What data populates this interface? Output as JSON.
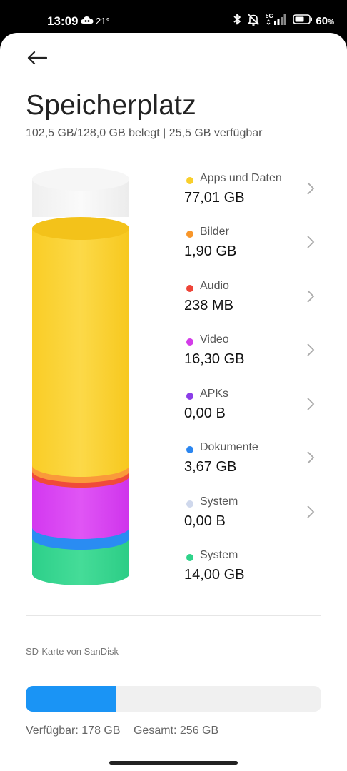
{
  "status_bar": {
    "time": "13:09",
    "temperature": "21°",
    "network": "5G",
    "battery": "60",
    "battery_unit": "%"
  },
  "header": {
    "title": "Speicherplatz",
    "subtitle": "102,5 GB/128,0 GB belegt | 25,5 GB verfügbar"
  },
  "storage_items": [
    {
      "label": "Apps und Daten",
      "value": "77,01 GB",
      "color": "#f9cf2c",
      "has_chevron": true
    },
    {
      "label": "Bilder",
      "value": "1,90 GB",
      "color": "#f8962a",
      "has_chevron": true
    },
    {
      "label": "Audio",
      "value": "238 MB",
      "color": "#ee4438",
      "has_chevron": true
    },
    {
      "label": "Video",
      "value": "16,30 GB",
      "color": "#d33ce8",
      "has_chevron": true
    },
    {
      "label": "APKs",
      "value": "0,00 B",
      "color": "#8b3ee8",
      "has_chevron": true
    },
    {
      "label": "Dokumente",
      "value": "3,67 GB",
      "color": "#2b86f0",
      "has_chevron": true
    },
    {
      "label": "System",
      "value": "0,00 B",
      "color": "#cfd8ec",
      "has_chevron": true
    },
    {
      "label": "System",
      "value": "14,00 GB",
      "color": "#2fd38a",
      "has_chevron": false
    }
  ],
  "sd_card": {
    "title": "SD-Karte von SanDisk",
    "used_fraction": 0.305,
    "fill_color": "#1a94f5",
    "available": "Verfügbar: 178 GB",
    "total": "Gesamt: 256 GB"
  }
}
